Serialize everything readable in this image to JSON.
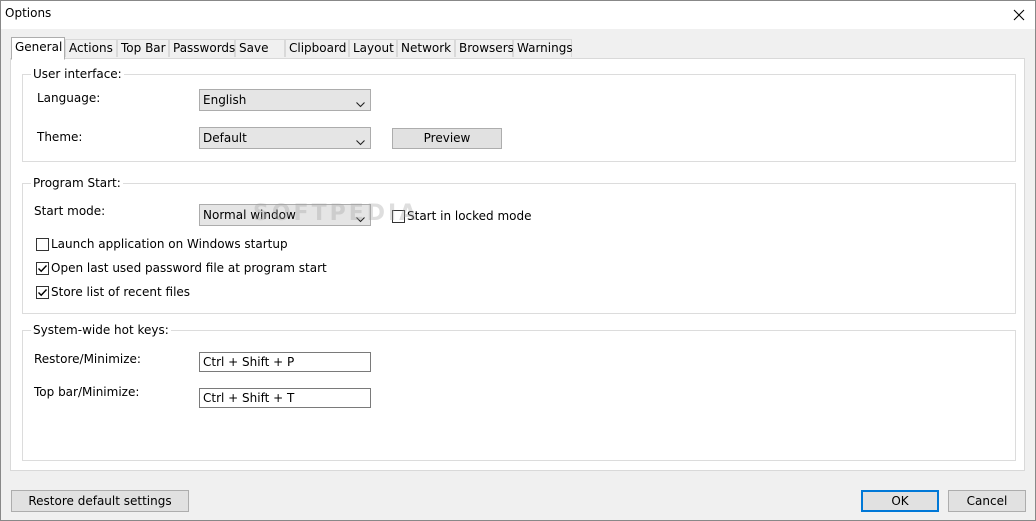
{
  "window": {
    "title": "Options"
  },
  "tabs": [
    {
      "label": "General",
      "active": true
    },
    {
      "label": "Actions"
    },
    {
      "label": "Top Bar"
    },
    {
      "label": "Passwords"
    },
    {
      "label": "Save"
    },
    {
      "label": "Clipboard"
    },
    {
      "label": "Layout"
    },
    {
      "label": "Network"
    },
    {
      "label": "Browsers"
    },
    {
      "label": "Warnings"
    }
  ],
  "user_interface": {
    "title": "User interface:",
    "language_label": "Language:",
    "language_value": "English",
    "theme_label": "Theme:",
    "theme_value": "Default",
    "preview_label": "Preview"
  },
  "program_start": {
    "title": "Program Start:",
    "start_mode_label": "Start mode:",
    "start_mode_value": "Normal window",
    "locked_mode_label": "Start in locked mode",
    "locked_mode_checked": false,
    "launch_startup_label": "Launch application on Windows startup",
    "launch_startup_checked": false,
    "open_last_label": "Open last used password file at program start",
    "open_last_checked": true,
    "store_recent_label": "Store list of recent files",
    "store_recent_checked": true
  },
  "hotkeys": {
    "title": "System-wide hot keys:",
    "restore_label": "Restore/Minimize:",
    "restore_value": "Ctrl + Shift + P",
    "topbar_label": "Top bar/Minimize:",
    "topbar_value": "Ctrl + Shift + T"
  },
  "footer": {
    "restore_defaults_label": "Restore default settings",
    "ok_label": "OK",
    "cancel_label": "Cancel"
  },
  "watermark": "SOFTPEDIA",
  "icons": [
    "close-icon",
    "chevron-down-icon",
    "checkmark-icon"
  ],
  "colors": {
    "accent": "#0078d7",
    "window_bg": "#f0f0f0",
    "page_bg": "#ffffff"
  }
}
